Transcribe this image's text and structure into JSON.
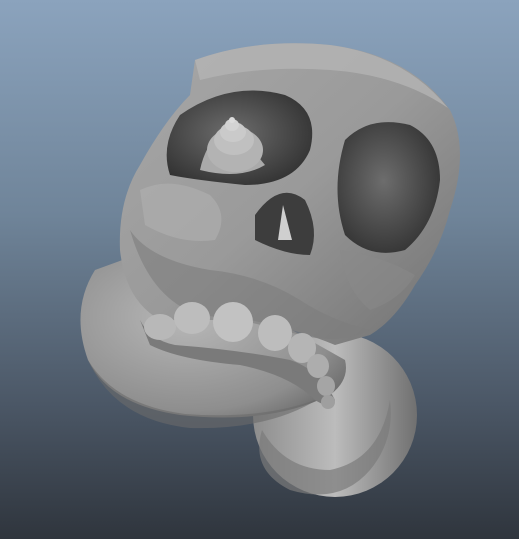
{
  "viewport": {
    "background_top": "#8ba3bd",
    "background_bottom": "#2f353d"
  },
  "model": {
    "name": "skull-ring-model",
    "material": "lambert-gray",
    "base_color": "#9a9a9a",
    "shadow_color": "#3f3f3f",
    "highlight_color": "#c9c9c9"
  }
}
